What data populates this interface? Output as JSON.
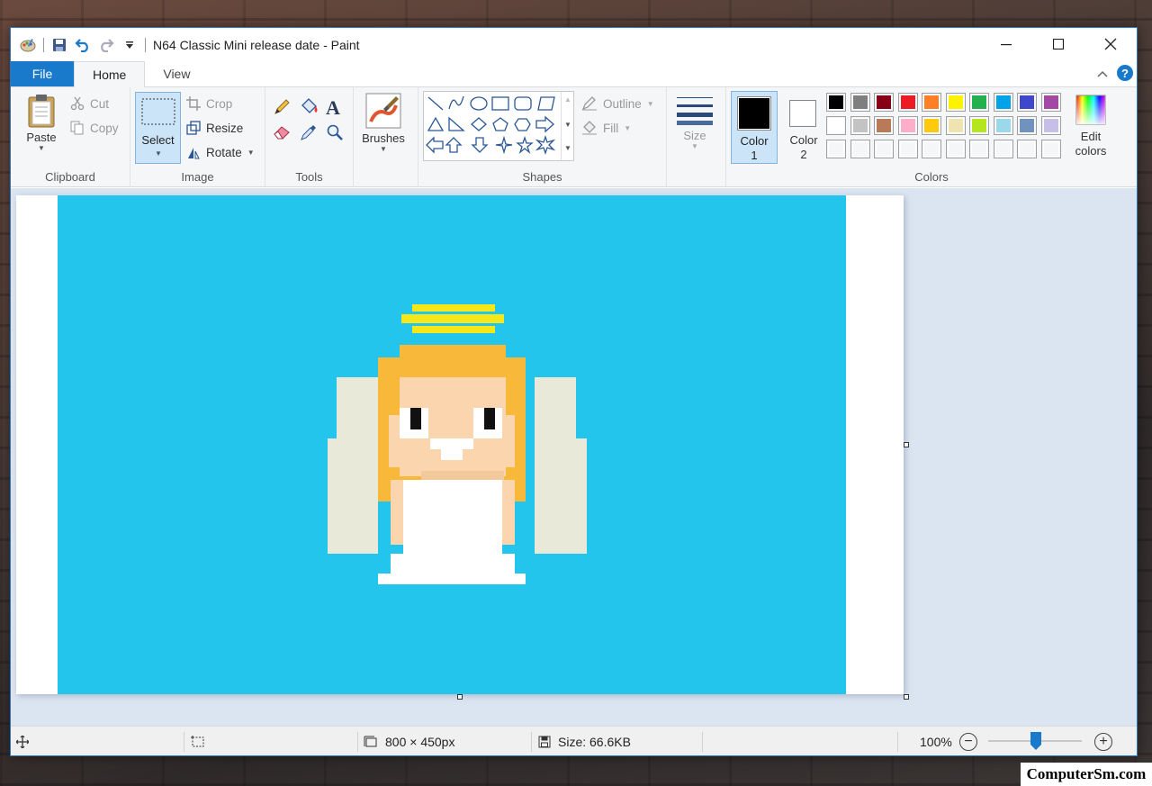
{
  "window": {
    "title": "N64 Classic Mini release date - Paint"
  },
  "tabs": {
    "file": "File",
    "home": "Home",
    "view": "View"
  },
  "clipboard": {
    "paste": "Paste",
    "cut": "Cut",
    "copy": "Copy",
    "label": "Clipboard"
  },
  "image": {
    "select": "Select",
    "crop": "Crop",
    "resize": "Resize",
    "rotate": "Rotate",
    "label": "Image"
  },
  "tools": {
    "label": "Tools"
  },
  "brushes": {
    "label": "Brushes"
  },
  "shapes": {
    "outline": "Outline",
    "fill": "Fill",
    "label": "Shapes"
  },
  "size": {
    "label": "Size"
  },
  "colors": {
    "color1_label": "Color",
    "color1_num": "1",
    "color2_label": "Color",
    "color2_num": "2",
    "edit1": "Edit",
    "edit2": "colors",
    "label": "Colors",
    "color1": "#000000",
    "color2": "#ffffff",
    "palette_row1": [
      "#000000",
      "#7f7f7f",
      "#880015",
      "#ed1c24",
      "#ff7f27",
      "#fff200",
      "#22b14c",
      "#00a2e8",
      "#3f48cc",
      "#a349a4"
    ],
    "palette_row2": [
      "#ffffff",
      "#c3c3c3",
      "#b97a57",
      "#ffaec9",
      "#ffc90e",
      "#efe4b0",
      "#b5e61d",
      "#99d9ea",
      "#7092be",
      "#c8bfe7"
    ],
    "palette_row3": [
      "#ffffff",
      "#ffffff",
      "#ffffff",
      "#ffffff",
      "#ffffff",
      "#ffffff",
      "#ffffff",
      "#ffffff",
      "#ffffff",
      "#ffffff"
    ]
  },
  "canvas": {
    "background": "#24c5ec"
  },
  "status": {
    "dimensions": "800 × 450px",
    "size": "Size: 66.6KB",
    "zoom": "100%",
    "zoom_level": 1.0
  },
  "watermark": "ComputerSm.com"
}
